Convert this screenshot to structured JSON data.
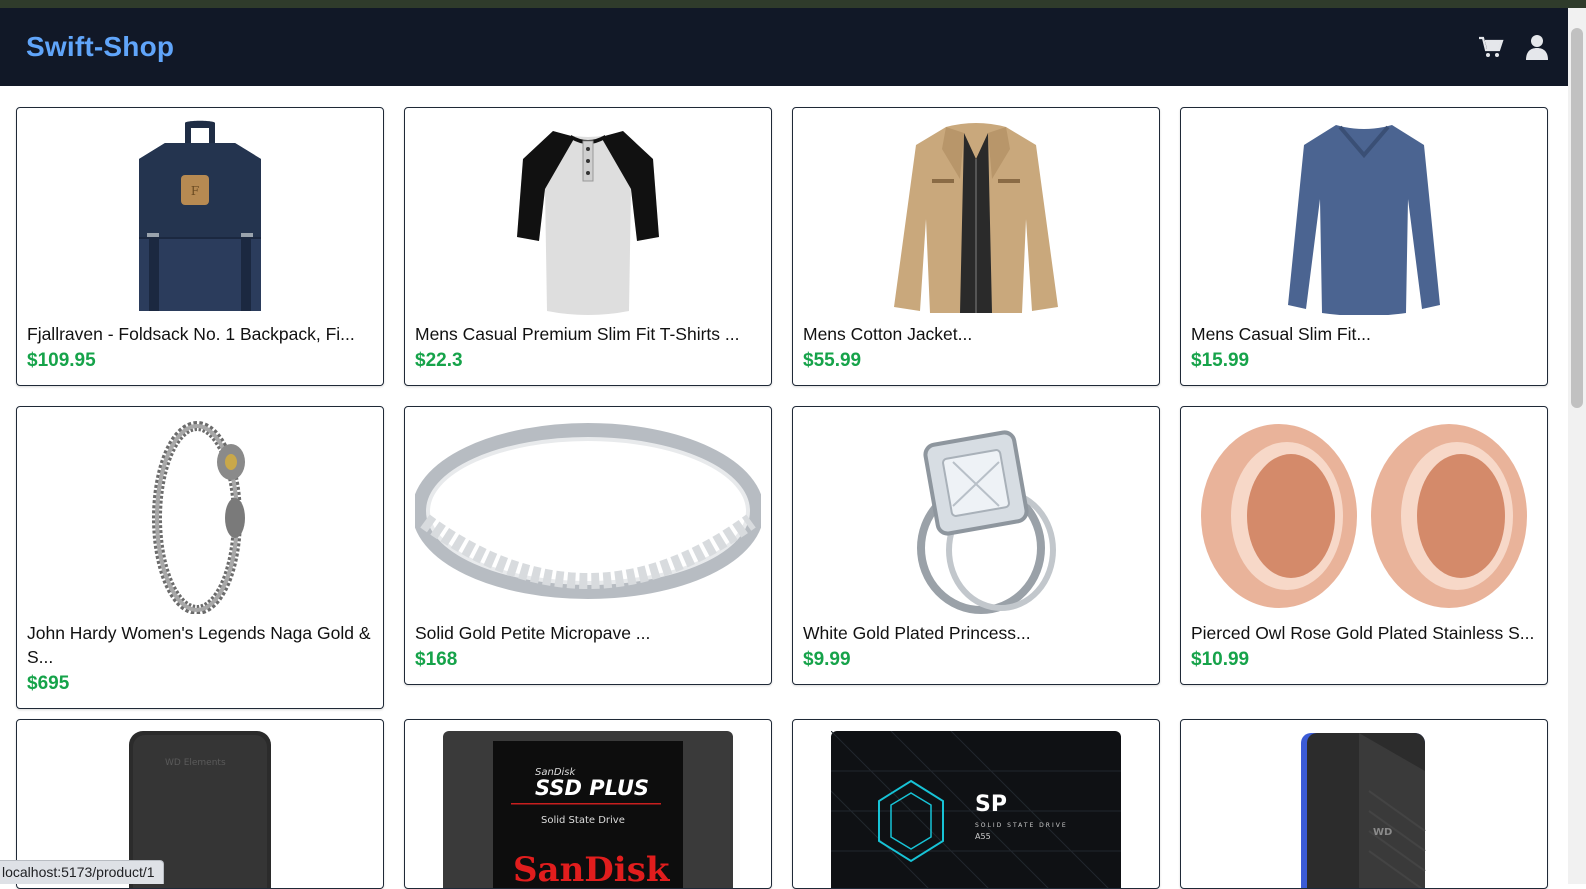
{
  "app": {
    "brand": "Swift-Shop",
    "cart_icon": "cart-icon",
    "user_icon": "user-icon"
  },
  "colors": {
    "navbar": "#111827",
    "brand": "#60a5fa",
    "price": "#16a34a"
  },
  "products": [
    {
      "title": "Fjallraven - Foldsack No. 1 Backpack, Fi...",
      "price": "$109.95",
      "image": "backpack"
    },
    {
      "title": "Mens Casual Premium Slim Fit T-Shirts ...",
      "price": "$22.3",
      "image": "raglan-tshirt"
    },
    {
      "title": "Mens Cotton Jacket...",
      "price": "$55.99",
      "image": "cotton-jacket"
    },
    {
      "title": "Mens Casual Slim Fit...",
      "price": "$15.99",
      "image": "long-sleeve-shirt"
    },
    {
      "title": "John Hardy Women's Legends Naga Gold & S...",
      "price": "$695",
      "image": "dragon-bracelet"
    },
    {
      "title": "Solid Gold Petite Micropave ...",
      "price": "$168",
      "image": "micropave-ring"
    },
    {
      "title": "White Gold Plated Princess...",
      "price": "$9.99",
      "image": "princess-ring"
    },
    {
      "title": "Pierced Owl Rose Gold Plated Stainless S...",
      "price": "$10.99",
      "image": "rose-gold-plugs"
    },
    {
      "image": "external-hard-drive",
      "drive_label": "WD Elements"
    },
    {
      "image": "sandisk-ssd",
      "ssd_brand": "SanDisk",
      "ssd_name": "SSD PLUS",
      "ssd_sub": "Solid State Drive",
      "ssd_logo": "SanDisk"
    },
    {
      "image": "silicon-power-ssd",
      "ssd_logo": "SP",
      "ssd_sub": "SOLID STATE DRIVE",
      "ssd_model": "A55"
    },
    {
      "image": "wd-gaming-drive",
      "drive_label": "WD"
    }
  ],
  "status": {
    "url": "localhost:5173/product/1"
  }
}
